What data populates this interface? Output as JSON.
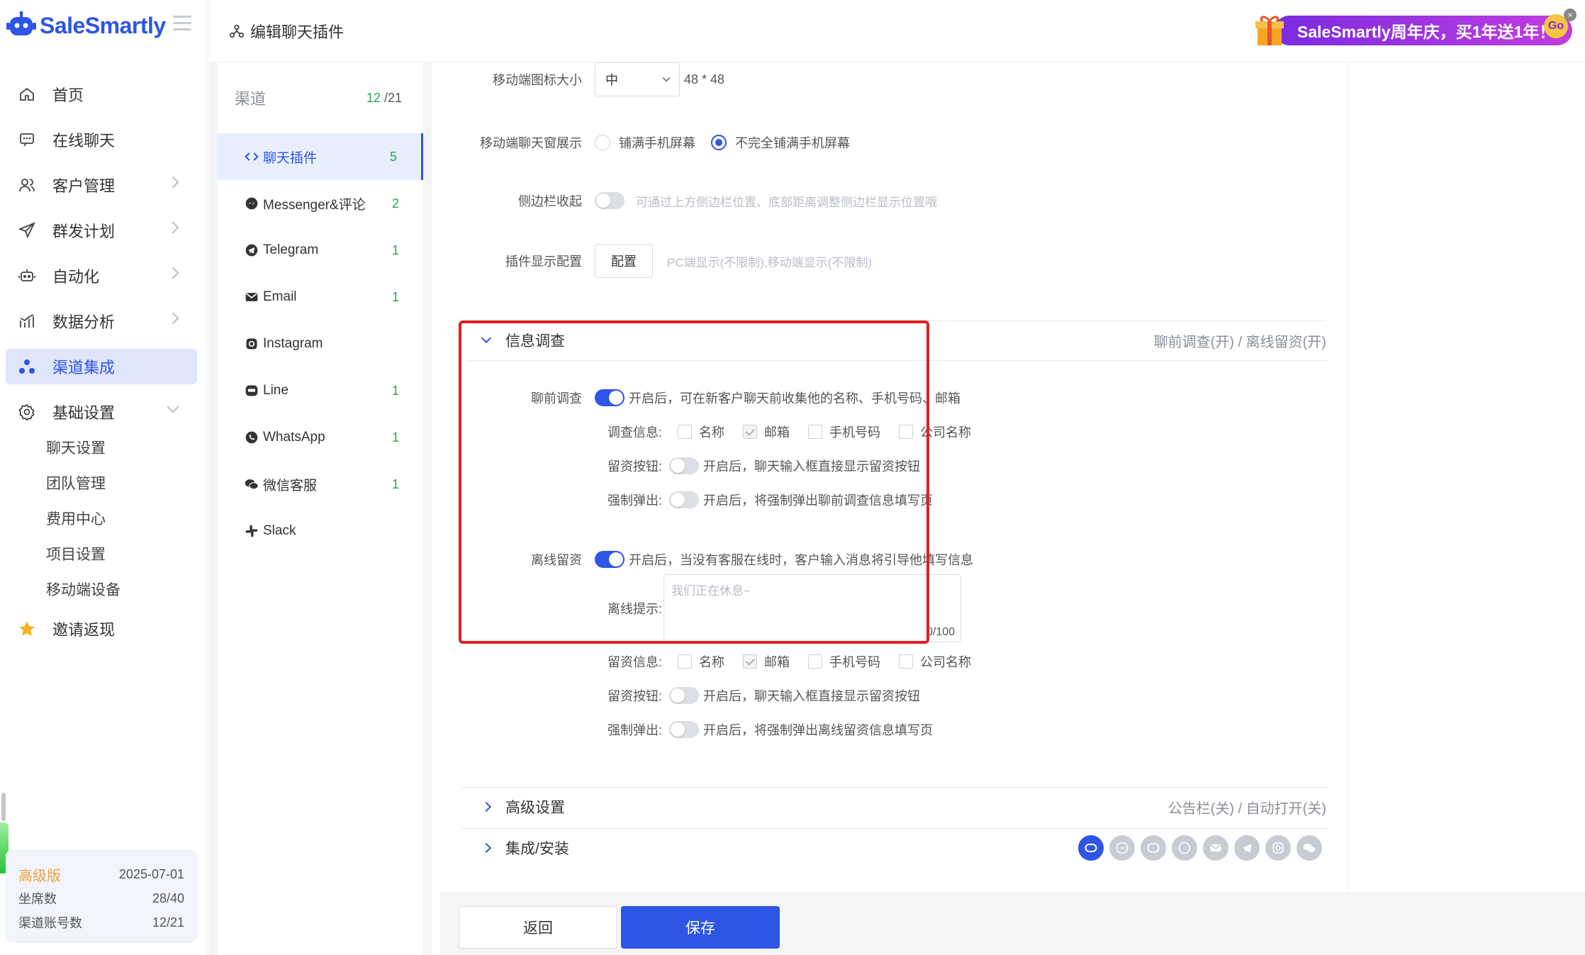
{
  "brand": {
    "name": "SaleSmartly",
    "accent": "#2d55e6"
  },
  "header": {
    "breadcrumb": "编辑聊天插件",
    "promo": "SaleSmartly周年庆，买1年送1年！",
    "promo_go": "Go"
  },
  "nav": [
    {
      "label": "首页",
      "icon": "home-icon"
    },
    {
      "label": "在线聊天",
      "icon": "chat-icon"
    },
    {
      "label": "客户管理",
      "icon": "users-icon"
    },
    {
      "label": "群发计划",
      "icon": "send-icon"
    },
    {
      "label": "自动化",
      "icon": "robot-icon"
    },
    {
      "label": "数据分析",
      "icon": "chart-icon"
    },
    {
      "label": "渠道集成",
      "icon": "channel-icon"
    },
    {
      "label": "基础设置",
      "icon": "gear-icon"
    }
  ],
  "sub_nav": [
    "聊天设置",
    "团队管理",
    "费用中心",
    "项目设置",
    "移动端设备"
  ],
  "invite": "邀请返现",
  "plan": {
    "name": "高级版",
    "date": "2025-07-01",
    "seats_label": "坐席数",
    "seats": "28/40",
    "accounts_label": "渠道账号数",
    "accounts": "12/21"
  },
  "channels": {
    "title": "渠道",
    "count_active": "12",
    "count_total": " /21",
    "items": [
      {
        "label": "聊天插件",
        "num": "5"
      },
      {
        "label": "Messenger&评论",
        "num": "2"
      },
      {
        "label": "Telegram",
        "num": "1"
      },
      {
        "label": "Email",
        "num": "1"
      },
      {
        "label": "Instagram",
        "num": ""
      },
      {
        "label": "Line",
        "num": "1"
      },
      {
        "label": "WhatsApp",
        "num": "1"
      },
      {
        "label": "微信客服",
        "num": "1"
      },
      {
        "label": "Slack",
        "num": ""
      }
    ]
  },
  "form": {
    "mobile_icon_size_label": "移动端图标大小",
    "mobile_icon_size_value": "中",
    "mobile_icon_size_dim": "48 * 48",
    "mobile_window_label": "移动端聊天窗展示",
    "mobile_window_opt1": "铺满手机屏幕",
    "mobile_window_opt2": "不完全铺满手机屏幕",
    "sidebar_collapse_label": "侧边栏收起",
    "sidebar_collapse_hint": "可通过上方侧边栏位置、底部距离调整侧边栏显示位置哦",
    "plugin_display_label": "插件显示配置",
    "plugin_display_button": "配置",
    "plugin_display_hint": "PC端显示(不限制),移动端显示(不限制)"
  },
  "survey": {
    "title": "信息调查",
    "status": "聊前调查(开) / 离线留资(开)",
    "pre_label": "聊前调查",
    "pre_desc": "开启后，可在新客户聊天前收集他的名称、手机号码、邮箱",
    "info_label": "调查信息:",
    "fields": [
      "名称",
      "邮箱",
      "手机号码",
      "公司名称"
    ],
    "leave_btn_label": "留资按钮:",
    "leave_btn_desc": "开启后，聊天输入框直接显示留资按钮",
    "force_label": "强制弹出:",
    "force_desc_pre": "开启后，将强制弹出聊前调查信息填写页",
    "offline_label": "离线留资",
    "offline_desc": "开启后，当没有客服在线时，客户输入消息将引导他填写信息",
    "offline_tip_label": "离线提示:",
    "offline_tip_placeholder": "我们正在休息~",
    "offline_tip_count": "0/100",
    "offline_info_label": "留资信息:",
    "force_desc_offline": "开启后，将强制弹出离线留资信息填写页"
  },
  "advanced": {
    "title": "高级设置",
    "status": "公告栏(关) / 自动打开(关)"
  },
  "integration": {
    "title": "集成/安装"
  },
  "buttons": {
    "back": "返回",
    "save": "保存"
  }
}
